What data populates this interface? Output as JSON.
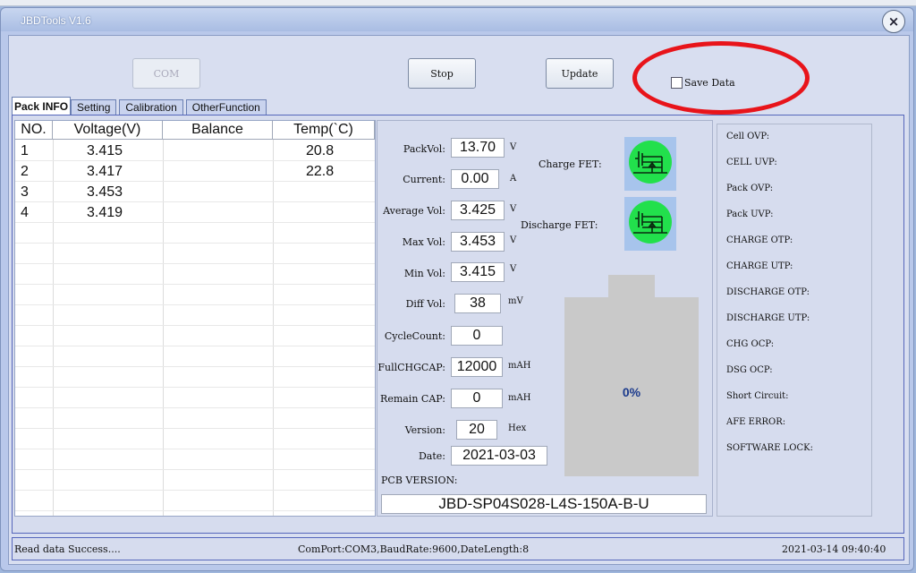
{
  "window": {
    "title": "JBDTools V1.6",
    "close_glyph": "×"
  },
  "toolbar": {
    "com_label": "COM",
    "stop_label": "Stop",
    "update_label": "Update",
    "save_data_label": "Save Data",
    "save_data_checked": false,
    "annotation_color": "#e8141a"
  },
  "tabs": [
    "Pack INFO",
    "Setting",
    "Calibration",
    "OtherFunction"
  ],
  "cell_table": {
    "headers": [
      "NO.",
      "Voltage(V)",
      "Balance",
      "Temp(`C)"
    ],
    "rows": [
      {
        "no": "1",
        "voltage": "3.415",
        "balance": "",
        "temp": "20.8"
      },
      {
        "no": "2",
        "voltage": "3.417",
        "balance": "",
        "temp": "22.8"
      },
      {
        "no": "3",
        "voltage": "3.453",
        "balance": "",
        "temp": ""
      },
      {
        "no": "4",
        "voltage": "3.419",
        "balance": "",
        "temp": ""
      }
    ]
  },
  "pack": {
    "pack_vol": {
      "label": "PackVol:",
      "value": "13.70",
      "unit": "V"
    },
    "current": {
      "label": "Current:",
      "value": "0.00",
      "unit": "A"
    },
    "average_vol": {
      "label": "Average Vol:",
      "value": "3.425",
      "unit": "V"
    },
    "max_vol": {
      "label": "Max Vol:",
      "value": "3.453",
      "unit": "V"
    },
    "min_vol": {
      "label": "Min Vol:",
      "value": "3.415",
      "unit": "V"
    },
    "diff_vol": {
      "label": "Diff Vol:",
      "value": "38",
      "unit": "mV"
    },
    "cycle_count": {
      "label": "CycleCount:",
      "value": "0"
    },
    "full_chg_cap": {
      "label": "FullCHGCAP:",
      "value": "12000",
      "unit": "mAH"
    },
    "remain_cap": {
      "label": "Remain CAP:",
      "value": "0",
      "unit": "mAH"
    },
    "version": {
      "label": "Version:",
      "value": "20",
      "unit": "Hex"
    },
    "date": {
      "label": "Date:",
      "value": "2021-03-03"
    },
    "pcb_version_label": "PCB VERSION:",
    "pcb_version": "JBD-SP04S028-L4S-150A-B-U"
  },
  "fets": {
    "charge_label": "Charge FET:",
    "discharge_label": "Discharge FET:",
    "on_color": "#22e04c"
  },
  "battery": {
    "percent_text": "0%",
    "percent": 0
  },
  "protections": [
    "Cell OVP:",
    "CELL UVP:",
    "Pack OVP:",
    "Pack UVP:",
    "CHARGE OTP:",
    "CHARGE UTP:",
    "DISCHARGE OTP:",
    "DISCHARGE UTP:",
    "CHG OCP:",
    "DSG OCP:",
    "Short Circuit:",
    "AFE ERROR:",
    "SOFTWARE LOCK:"
  ],
  "status": {
    "message": "Read data Success....",
    "port_info": "ComPort:COM3,BaudRate:9600,DateLength:8",
    "timestamp": "2021-03-14 09:40:40"
  }
}
